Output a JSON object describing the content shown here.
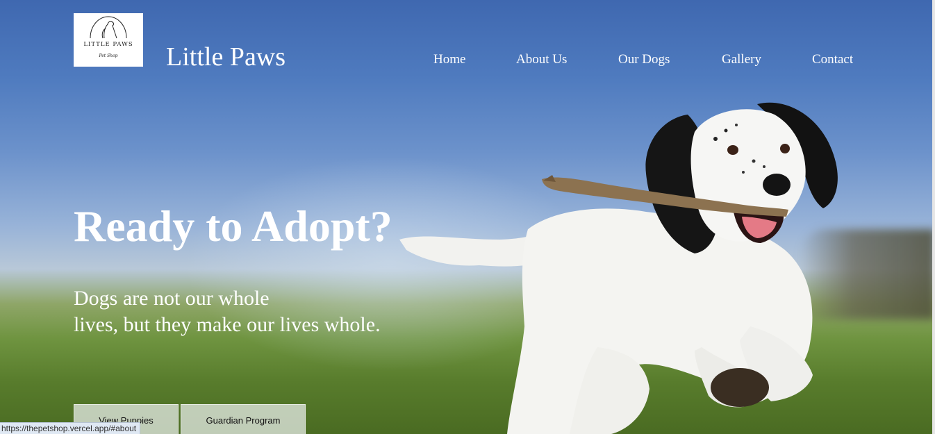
{
  "logo": {
    "main": "LITTLE PAWS",
    "sub": "Pet Shop"
  },
  "brand": {
    "title": "Little Paws"
  },
  "nav": {
    "items": [
      "Home",
      "About Us",
      "Our Dogs",
      "Gallery",
      "Contact"
    ]
  },
  "hero": {
    "headline": "Ready to Adopt?",
    "tagline_line1": "Dogs are not our whole",
    "tagline_line2": "lives, but they make our lives whole.",
    "buttons": [
      "View Puppies",
      "Guardian Program"
    ]
  },
  "status_bar": {
    "url": "https://thepetshop.vercel.app/#about"
  },
  "colors": {
    "sky": "#4f7bbf",
    "grass": "#587c2c",
    "text": "#ffffff"
  }
}
